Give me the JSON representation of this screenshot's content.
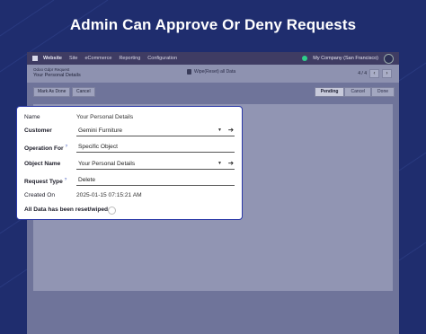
{
  "headline": "Admin Can Approve Or Deny Requests",
  "navbar": {
    "app_name": "Website",
    "menu": [
      "Site",
      "eCommerce",
      "Reporting",
      "Configuration"
    ],
    "company": "My Company (San Francisco)"
  },
  "breadcrumb": {
    "parent": "Odoo Gdpr Request",
    "current": "Your Personal Details"
  },
  "control": {
    "reset_label": "Wipe(Reset) all Data",
    "pager": "4 / 4"
  },
  "actions": {
    "mark_done": "Mark As Done",
    "cancel": "Cancel"
  },
  "statuses": [
    {
      "label": "Pending",
      "active": true
    },
    {
      "label": "Cancel",
      "active": false
    },
    {
      "label": "Done",
      "active": false
    }
  ],
  "form": {
    "name_label": "Name",
    "name_value": "Your Personal Details",
    "customer_label": "Customer",
    "customer_value": "Gemini Furniture",
    "operation_label": "Operation For",
    "operation_value": "Specific Object",
    "object_label": "Object Name",
    "object_value": "Your Personal Details",
    "request_label": "Request Type",
    "request_value": "Delete",
    "created_label": "Created On",
    "created_value": "2025-01-15 07:15:21 AM",
    "wiped_label": "All Data has been reset/wiped",
    "wiped_value": false
  },
  "colors": {
    "background": "#1f2d6e",
    "card_border": "#2b3aa8",
    "accent": "#2ecf8a"
  }
}
